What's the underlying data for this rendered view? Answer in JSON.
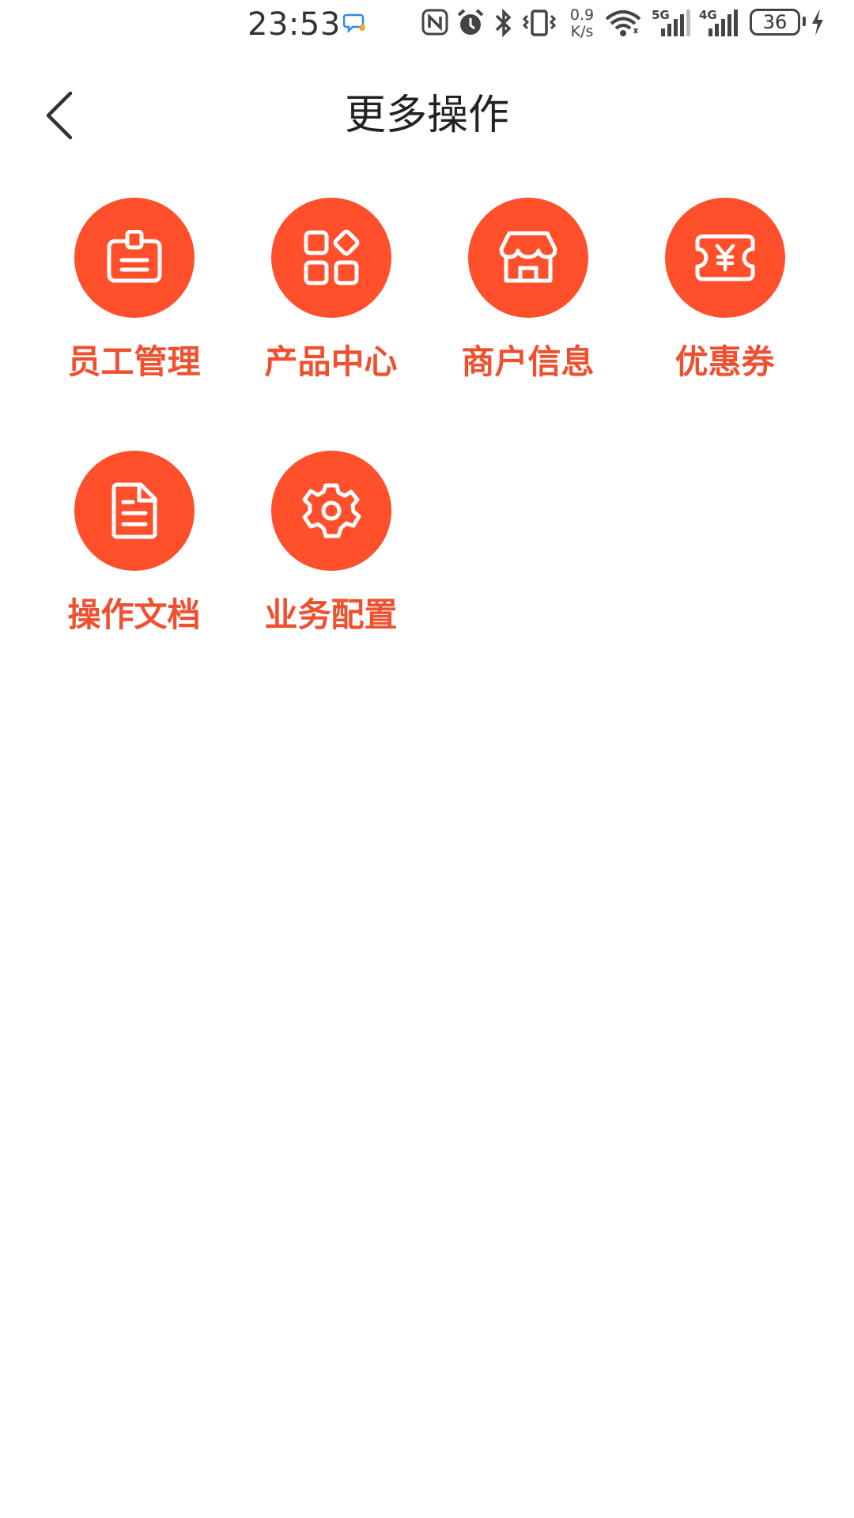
{
  "status_bar": {
    "time": "23:53",
    "net_speed_value": "0.9",
    "net_speed_unit": "K/s",
    "signal1_label": "5G",
    "signal2_label": "4G",
    "battery_level": "36"
  },
  "header": {
    "title": "更多操作"
  },
  "grid": {
    "items": [
      {
        "label": "员工管理",
        "icon": "id-badge-icon"
      },
      {
        "label": "产品中心",
        "icon": "apps-grid-icon"
      },
      {
        "label": "商户信息",
        "icon": "store-icon"
      },
      {
        "label": "优惠券",
        "icon": "coupon-icon"
      },
      {
        "label": "操作文档",
        "icon": "document-icon"
      },
      {
        "label": "业务配置",
        "icon": "gear-icon"
      }
    ]
  },
  "colors": {
    "accent": "#ff4f2b",
    "label": "#f0502f",
    "title": "#222222",
    "background": "#ffffff"
  }
}
